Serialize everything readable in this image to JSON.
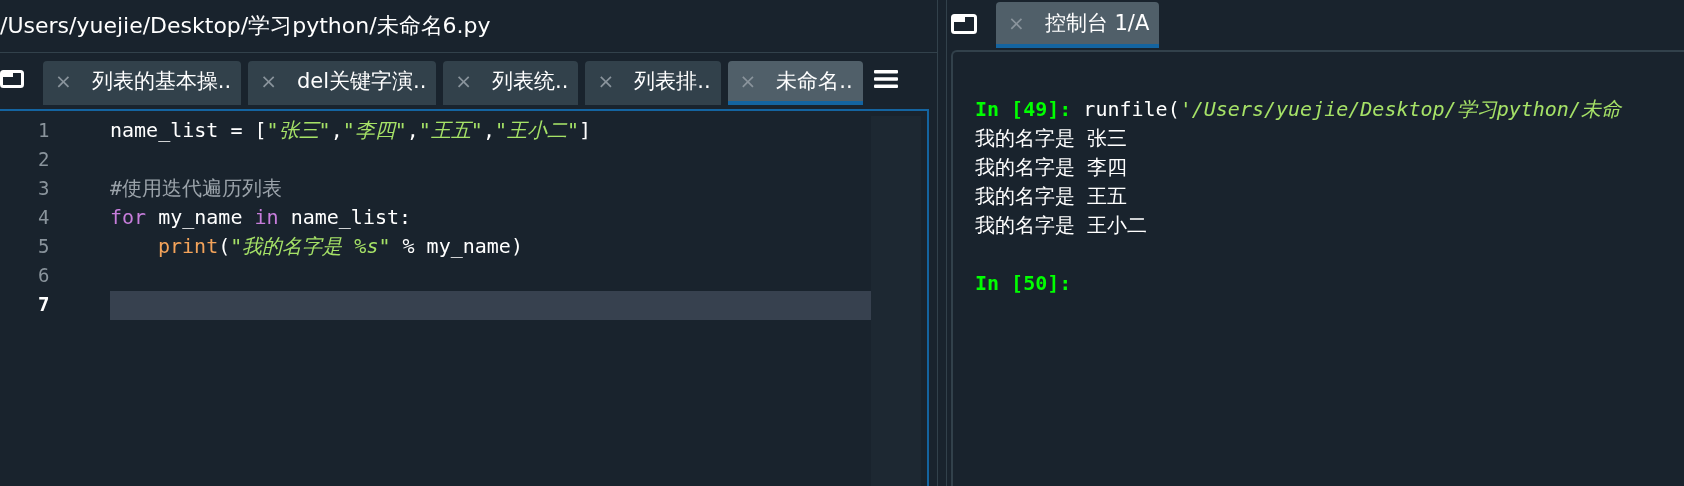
{
  "editor_pane": {
    "path": "/Users/yuejie/Desktop/学习python/未命名6.py",
    "tabs": [
      {
        "close": "×",
        "label": "列表的基本操..",
        "selected": false
      },
      {
        "close": "×",
        "label": "del关键字演..",
        "selected": false
      },
      {
        "close": "×",
        "label": "列表统..",
        "selected": false
      },
      {
        "close": "×",
        "label": "列表排..",
        "selected": false
      },
      {
        "close": "×",
        "label": "未命名..",
        "selected": true
      }
    ],
    "lines": [
      {
        "number": "1",
        "current": false,
        "tokens": [
          {
            "kind": "plain",
            "text": "name_list = ["
          },
          {
            "kind": "string",
            "text": "\"张三\""
          },
          {
            "kind": "plain",
            "text": ","
          },
          {
            "kind": "string",
            "text": "\"李四\""
          },
          {
            "kind": "plain",
            "text": ","
          },
          {
            "kind": "string",
            "text": "\"王五\""
          },
          {
            "kind": "plain",
            "text": ","
          },
          {
            "kind": "string",
            "text": "\"王小二\""
          },
          {
            "kind": "plain",
            "text": "]"
          }
        ]
      },
      {
        "number": "2",
        "current": false
      },
      {
        "number": "3",
        "current": false,
        "tokens": [
          {
            "kind": "comment",
            "text": "#使用迭代遍历列表"
          }
        ]
      },
      {
        "number": "4",
        "current": false,
        "tokens": [
          {
            "kind": "keyword",
            "text": "for"
          },
          {
            "kind": "plain",
            "text": " my_name "
          },
          {
            "kind": "keyword",
            "text": "in"
          },
          {
            "kind": "plain",
            "text": " name_list:"
          }
        ]
      },
      {
        "number": "5",
        "current": false,
        "indented": true,
        "tokens": [
          {
            "kind": "builtin",
            "text": "print"
          },
          {
            "kind": "plain",
            "text": "("
          },
          {
            "kind": "string",
            "text": "\"我的名字是 %s\""
          },
          {
            "kind": "plain",
            "text": " % my_name)"
          }
        ]
      },
      {
        "number": "6",
        "current": false
      },
      {
        "number": "7",
        "current": true
      }
    ]
  },
  "console_pane": {
    "tabs": [
      {
        "close": "×",
        "label": "控制台 1/A",
        "selected": true
      }
    ],
    "lines": [
      {
        "tokens": [
          {
            "kind": "prompt",
            "text": "In [49]:"
          },
          {
            "kind": "plain",
            "text": " runfile("
          },
          {
            "kind": "string",
            "text": "'/Users/yuejie/Desktop/学习python/未命"
          }
        ]
      },
      {
        "tokens": [
          {
            "kind": "plain",
            "text": "我的名字是 张三"
          }
        ]
      },
      {
        "tokens": [
          {
            "kind": "plain",
            "text": "我的名字是 李四"
          }
        ]
      },
      {
        "tokens": [
          {
            "kind": "plain",
            "text": "我的名字是 王五"
          }
        ]
      },
      {
        "tokens": [
          {
            "kind": "plain",
            "text": "我的名字是 王小二"
          }
        ]
      },
      {
        "spaced": true,
        "tokens": [
          {
            "kind": "prompt",
            "text": "In [50]:"
          }
        ]
      }
    ]
  }
}
